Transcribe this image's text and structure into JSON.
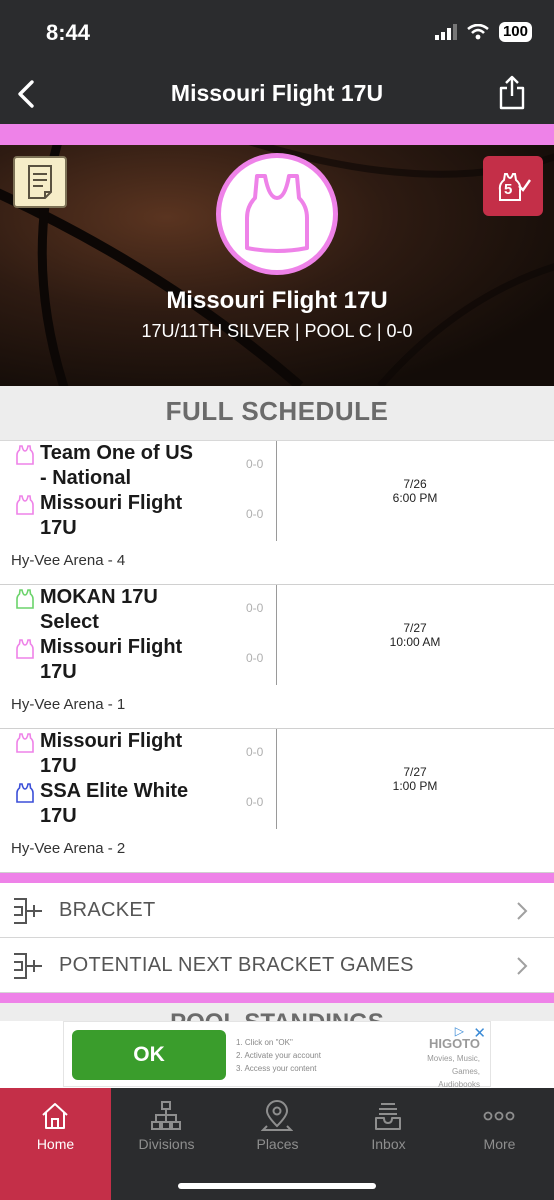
{
  "status": {
    "time": "8:44",
    "battery": "100"
  },
  "nav": {
    "title": "Missouri Flight 17U",
    "back_icon": "chevron-left-icon",
    "share_icon": "share-icon"
  },
  "colors": {
    "accent_pink": "#ee82e8",
    "brand_red": "#c42f48",
    "dark": "#2b2c2e",
    "green_team": "#6bd36b",
    "blue_team": "#3b4fd8"
  },
  "hero": {
    "team_name": "Missouri Flight 17U",
    "subtitle": "17U/11TH SILVER | POOL C | 0-0",
    "rank_badge": "5"
  },
  "schedule": {
    "heading": "FULL SCHEDULE",
    "games": [
      {
        "teams": [
          {
            "name": "Team One of US - National",
            "score": "0-0",
            "jersey_color": "#ee82e8"
          },
          {
            "name": "Missouri Flight 17U",
            "score": "0-0",
            "jersey_color": "#ee82e8"
          }
        ],
        "date": "7/26",
        "time": "6:00 PM",
        "location": "Hy-Vee Arena - 4"
      },
      {
        "teams": [
          {
            "name": "MOKAN 17U Select",
            "score": "0-0",
            "jersey_color": "#6bd36b"
          },
          {
            "name": "Missouri Flight 17U",
            "score": "0-0",
            "jersey_color": "#ee82e8"
          }
        ],
        "date": "7/27",
        "time": "10:00 AM",
        "location": "Hy-Vee Arena - 1"
      },
      {
        "teams": [
          {
            "name": "Missouri Flight 17U",
            "score": "0-0",
            "jersey_color": "#ee82e8"
          },
          {
            "name": "SSA Elite White 17U",
            "score": "0-0",
            "jersey_color": "#3b4fd8"
          }
        ],
        "date": "7/27",
        "time": "1:00 PM",
        "location": "Hy-Vee Arena - 2"
      }
    ]
  },
  "links": {
    "bracket": "BRACKET",
    "potential": "POTENTIAL NEXT BRACKET GAMES"
  },
  "pool_heading": "POOL STANDINGS",
  "ad": {
    "button": "OK",
    "step1": "1. Click on \"OK\"",
    "step2": "2. Activate your account",
    "step3": "3. Access your content",
    "brand": "HIGOTO",
    "cats1": "Movies, Music,",
    "cats2": "Games, Audiobooks"
  },
  "tabs": [
    {
      "label": "Home",
      "icon": "home-icon",
      "active": true
    },
    {
      "label": "Divisions",
      "icon": "hierarchy-icon",
      "active": false
    },
    {
      "label": "Places",
      "icon": "map-pin-icon",
      "active": false
    },
    {
      "label": "Inbox",
      "icon": "inbox-icon",
      "active": false
    },
    {
      "label": "More",
      "icon": "more-dots-icon",
      "active": false
    }
  ]
}
